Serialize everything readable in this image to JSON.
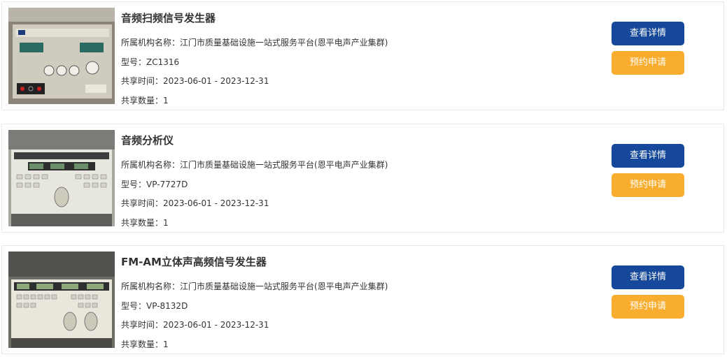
{
  "items": [
    {
      "title": "音频扫频信号发生器",
      "org_label": "所属机构名称：",
      "org": "江门市质量基础设施一站式服务平台(恩平电声产业集群)",
      "model_label": "型号：",
      "model": "ZC1316",
      "time_label": "共享时间：",
      "time": "2023-06-01 - 2023-12-31",
      "qty_label": "共享数量：",
      "qty": "1",
      "detail_label": "查看详情",
      "apply_label": "预约申请"
    },
    {
      "title": "音频分析仪",
      "org_label": "所属机构名称：",
      "org": "江门市质量基础设施一站式服务平台(恩平电声产业集群)",
      "model_label": "型号：",
      "model": "VP-7727D",
      "time_label": "共享时间：",
      "time": "2023-06-01 - 2023-12-31",
      "qty_label": "共享数量：",
      "qty": "1",
      "detail_label": "查看详情",
      "apply_label": "预约申请"
    },
    {
      "title": "FM-AM立体声高频信号发生器",
      "org_label": "所属机构名称：",
      "org": "江门市质量基础设施一站式服务平台(恩平电声产业集群)",
      "model_label": "型号：",
      "model": "VP-8132D",
      "time_label": "共享时间：",
      "time": "2023-06-01 - 2023-12-31",
      "qty_label": "共享数量：",
      "qty": "1",
      "detail_label": "查看详情",
      "apply_label": "预约申请"
    }
  ],
  "colors": {
    "detail_button": "#15489a",
    "apply_button": "#f8ad2f"
  }
}
